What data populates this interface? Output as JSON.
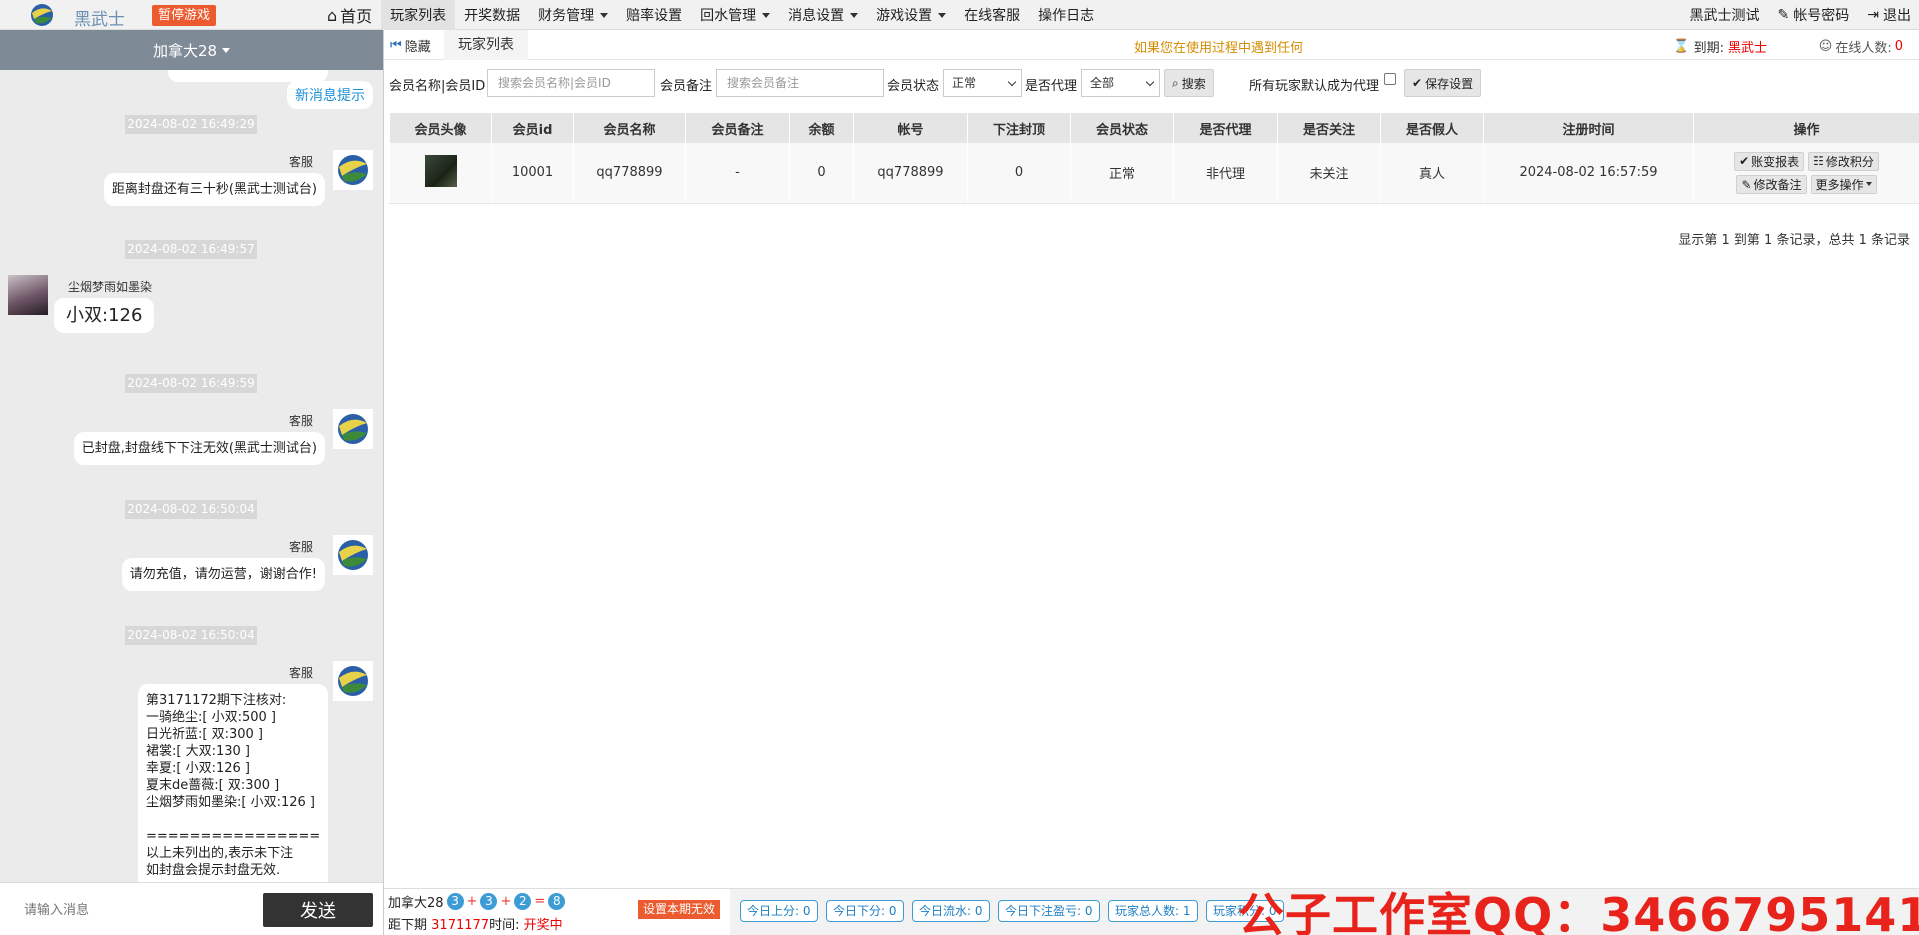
{
  "nav": {
    "brand": "黑武士",
    "pause_label": "暂停游戏",
    "menu": [
      {
        "label": "首页"
      },
      {
        "label": "玩家列表"
      },
      {
        "label": "开奖数据"
      },
      {
        "label": "财务管理"
      },
      {
        "label": "赔率设置"
      },
      {
        "label": "回水管理"
      },
      {
        "label": "消息设置"
      },
      {
        "label": "游戏设置"
      },
      {
        "label": "在线客服"
      },
      {
        "label": "操作日志"
      }
    ],
    "user_name": "黑武士测试",
    "password_label": "帐号密码",
    "logout_label": "退出"
  },
  "chat": {
    "room_title": "加拿大28",
    "new_msg_tip": "新消息提示",
    "messages": [
      {
        "time": "2024-08-02 16:49:29",
        "sender": "客服",
        "text": "距离封盘还有三十秒(黑武士测试台)"
      },
      {
        "time": "2024-08-02 16:49:57",
        "sender": "尘烟梦雨如墨染",
        "text": "小双:126"
      },
      {
        "time": "2024-08-02 16:49:59",
        "sender": "客服",
        "text": "已封盘,封盘线下下注无效(黑武士测试台)"
      },
      {
        "time": "2024-08-02 16:50:04",
        "sender": "客服",
        "text": "请勿充值，请勿运营，谢谢合作!"
      },
      {
        "time": "2024-08-02 16:50:04",
        "sender": "客服",
        "text": "第3171172期下注核对:\n一骑绝尘:[ 小双:500 ]\n日光祈蓝:[ 双:300 ]\n裙裳:[ 大双:130 ]\n幸夏:[ 小双:126 ]\n夏末de蔷薇:[ 双:300 ]\n尘烟梦雨如墨染:[ 小双:126 ]\n\n================\n以上未列出的,表示未下注\n如封盘会提示封盘无效."
      }
    ],
    "input_placeholder": "请输入消息",
    "send_label": "发送"
  },
  "tabs": {
    "hide_label": "隐藏",
    "active_tab": "玩家列表",
    "notice": "如果您在使用过程中遇到任何",
    "expire_label": "到期:",
    "expire_value": "黑武士",
    "online_label": "在线人数:",
    "online_value": "0"
  },
  "filters": {
    "name_label": "会员名称|会员ID",
    "name_placeholder": "搜索会员名称|会员ID",
    "remark_label": "会员备注",
    "remark_placeholder": "搜索会员备注",
    "status_label": "会员状态",
    "status_value": "正常",
    "agent_label": "是否代理",
    "agent_value": "全部",
    "search_label": "搜索",
    "default_agent_label": "所有玩家默认成为代理",
    "save_label": "保存设置"
  },
  "table": {
    "columns": [
      "会员头像",
      "会员id",
      "会员名称",
      "会员备注",
      "余额",
      "帐号",
      "下注封顶",
      "会员状态",
      "是否代理",
      "是否关注",
      "是否假人",
      "注册时间",
      "操作"
    ],
    "rows": [
      {
        "id": "10001",
        "name": "qq778899",
        "remark": "-",
        "balance": "0",
        "account": "qq778899",
        "bet_cap": "0",
        "status": "正常",
        "agent": "非代理",
        "follow": "未关注",
        "fake": "真人",
        "reg_time": "2024-08-02 16:57:59"
      }
    ],
    "actions": {
      "report": "账变报表",
      "points": "修改积分",
      "remark": "修改备注",
      "more": "更多操作"
    },
    "pager": "显示第 1 到第 1 条记录，总共 1 条记录"
  },
  "bottom": {
    "game": "加拿大28",
    "balls": [
      "3",
      "3",
      "2",
      "8"
    ],
    "ops": [
      "+",
      "+",
      "="
    ],
    "period_label": "距下期",
    "period_value": "3171177",
    "time_label": "时间:",
    "time_value": "开奖中",
    "invalid_label": "设置本期无效",
    "stats": [
      "今日上分: 0",
      "今日下分: 0",
      "今日流水: 0",
      "今日下注盈亏: 0",
      "玩家总人数: 1",
      "玩家积分: 0"
    ]
  },
  "watermark": "公子工作室QQ：3466795141",
  "colors": {
    "accent_orange": "#ec5b2f",
    "ball_blue": "#3c9dd6",
    "header_gray": "#7f8a97",
    "watermark_red": "#e8231c"
  }
}
